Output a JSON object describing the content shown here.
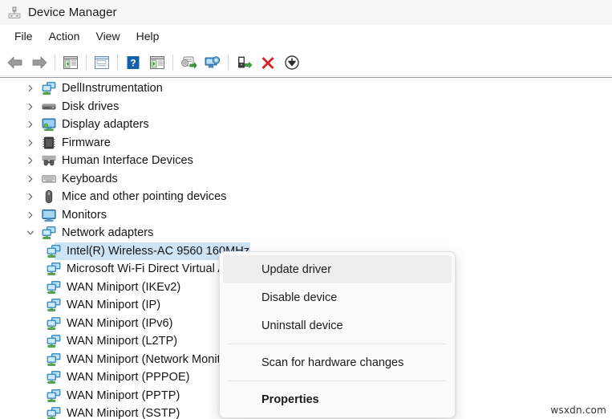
{
  "window": {
    "title": "Device Manager",
    "title_icon": "device-manager-icon"
  },
  "menubar": {
    "items": [
      {
        "label": "File",
        "name": "menu-file"
      },
      {
        "label": "Action",
        "name": "menu-action"
      },
      {
        "label": "View",
        "name": "menu-view"
      },
      {
        "label": "Help",
        "name": "menu-help"
      }
    ]
  },
  "toolbar": {
    "buttons": [
      {
        "icon": "back-arrow-icon",
        "label": "Back"
      },
      {
        "icon": "forward-arrow-icon",
        "label": "Forward"
      },
      {
        "icon": "show-hide-console-tree-icon",
        "label": "Show/Hide Console Tree"
      },
      {
        "icon": "properties-icon",
        "label": "Properties"
      },
      {
        "icon": "help-icon",
        "label": "Help"
      },
      {
        "icon": "show-hide-action-pane-icon",
        "label": "Show/Hide Action Pane"
      },
      {
        "icon": "update-driver-icon",
        "label": "Update driver"
      },
      {
        "icon": "scan-for-hardware-changes-icon",
        "label": "Scan for hardware changes"
      },
      {
        "icon": "disable-device-icon",
        "label": "Disable device"
      },
      {
        "icon": "uninstall-device-icon",
        "label": "Uninstall device"
      },
      {
        "icon": "download-icon",
        "label": "Update"
      }
    ]
  },
  "tree": {
    "rows": [
      {
        "label": "DellInstrumentation",
        "icon": "network-computers-icon",
        "level": 0,
        "expanded": false,
        "selected": false
      },
      {
        "label": "Disk drives",
        "icon": "disk-drive-icon",
        "level": 0,
        "expanded": false,
        "selected": false
      },
      {
        "label": "Display adapters",
        "icon": "display-adapter-icon",
        "level": 0,
        "expanded": false,
        "selected": false
      },
      {
        "label": "Firmware",
        "icon": "firmware-chip-icon",
        "level": 0,
        "expanded": false,
        "selected": false
      },
      {
        "label": "Human Interface Devices",
        "icon": "human-interface-icon",
        "level": 0,
        "expanded": false,
        "selected": false
      },
      {
        "label": "Keyboards",
        "icon": "keyboard-icon",
        "level": 0,
        "expanded": false,
        "selected": false
      },
      {
        "label": "Mice and other pointing devices",
        "icon": "mouse-icon",
        "level": 0,
        "expanded": false,
        "selected": false
      },
      {
        "label": "Monitors",
        "icon": "monitor-icon",
        "level": 0,
        "expanded": false,
        "selected": false
      },
      {
        "label": "Network adapters",
        "icon": "network-computers-icon",
        "level": 0,
        "expanded": true,
        "selected": false
      },
      {
        "label": "Intel(R) Wireless-AC 9560 160MHz",
        "icon": "network-adapter-icon",
        "level": 1,
        "expanded": false,
        "selected": true
      },
      {
        "label": "Microsoft Wi-Fi Direct Virtual Adapter",
        "icon": "network-adapter-icon",
        "level": 1,
        "expanded": false,
        "selected": false
      },
      {
        "label": "WAN Miniport (IKEv2)",
        "icon": "network-adapter-icon",
        "level": 1,
        "expanded": false,
        "selected": false
      },
      {
        "label": "WAN Miniport (IP)",
        "icon": "network-adapter-icon",
        "level": 1,
        "expanded": false,
        "selected": false
      },
      {
        "label": "WAN Miniport (IPv6)",
        "icon": "network-adapter-icon",
        "level": 1,
        "expanded": false,
        "selected": false
      },
      {
        "label": "WAN Miniport (L2TP)",
        "icon": "network-adapter-icon",
        "level": 1,
        "expanded": false,
        "selected": false
      },
      {
        "label": "WAN Miniport (Network Monitor)",
        "icon": "network-adapter-icon",
        "level": 1,
        "expanded": false,
        "selected": false
      },
      {
        "label": "WAN Miniport (PPPOE)",
        "icon": "network-adapter-icon",
        "level": 1,
        "expanded": false,
        "selected": false
      },
      {
        "label": "WAN Miniport (PPTP)",
        "icon": "network-adapter-icon",
        "level": 1,
        "expanded": false,
        "selected": false
      },
      {
        "label": "WAN Miniport (SSTP)",
        "icon": "network-adapter-icon",
        "level": 1,
        "expanded": false,
        "selected": false
      }
    ]
  },
  "context_menu": {
    "items": [
      {
        "label": "Update driver",
        "name": "ctx-update-driver",
        "highlight": true,
        "bold": false
      },
      {
        "label": "Disable device",
        "name": "ctx-disable-device",
        "highlight": false,
        "bold": false
      },
      {
        "label": "Uninstall device",
        "name": "ctx-uninstall-device",
        "highlight": false,
        "bold": false
      },
      {
        "separator": true
      },
      {
        "label": "Scan for hardware changes",
        "name": "ctx-scan-hardware-changes",
        "highlight": false,
        "bold": false
      },
      {
        "separator": true
      },
      {
        "label": "Properties",
        "name": "ctx-properties",
        "highlight": false,
        "bold": true
      }
    ]
  },
  "watermark": {
    "text": "wsxdn.com"
  },
  "colors": {
    "selection": "#cde4f7",
    "menu_highlight": "#ededed",
    "titlebar": "#f7f7f7",
    "text": "#141414"
  }
}
